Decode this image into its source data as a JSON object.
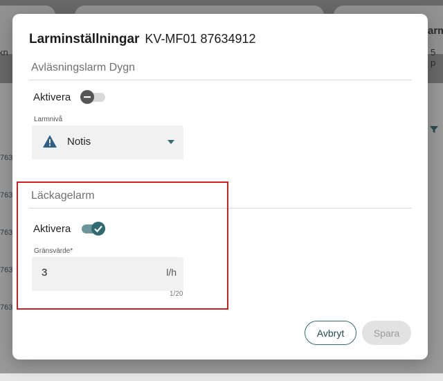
{
  "background": {
    "header_fragment": "arm",
    "left_fragment": "kn",
    "right_fragment": "5 p",
    "row_fragments": [
      "763",
      "763",
      "763",
      "763",
      "763"
    ]
  },
  "dialog": {
    "title": "Larminställningar",
    "subtitle": "KV-MF01 87634912",
    "daily_alarm": {
      "section_title": "Avläsningslarm Dygn",
      "toggle_label": "Aktivera",
      "toggle_state": "off",
      "level_label": "Larmnivå",
      "level_value": "Notis",
      "level_icon": "warning-icon"
    },
    "leak_alarm": {
      "section_title": "Läckagelarm",
      "toggle_label": "Aktivera",
      "toggle_state": "on",
      "threshold_label": "Gränsvärde*",
      "threshold_value": "3",
      "threshold_unit": "l/h",
      "counter": "1/20"
    },
    "buttons": {
      "cancel": "Avbryt",
      "save": "Spara"
    }
  },
  "colors": {
    "accent": "#2e6a70",
    "highlight": "#d01f1f"
  }
}
